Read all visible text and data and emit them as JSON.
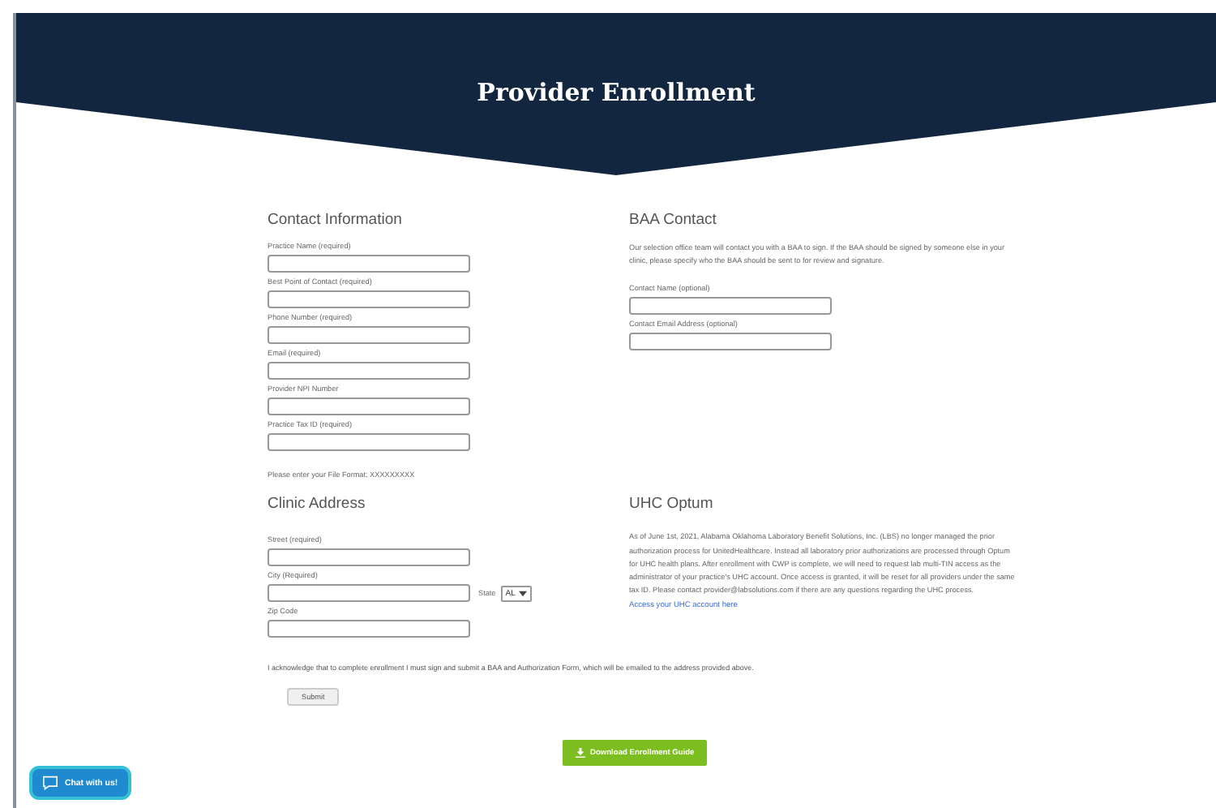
{
  "header": {
    "title": "Provider Enrollment"
  },
  "contact_information": {
    "heading": "Contact Information",
    "fields": [
      {
        "label": "Practice Name (required)"
      },
      {
        "label": "Best Point of Contact (required)"
      },
      {
        "label": "Phone Number (required)"
      },
      {
        "label": "Email (required)"
      },
      {
        "label": "Provider NPI Number"
      },
      {
        "label": "Practice Tax ID (required)"
      }
    ],
    "note": "Please enter your File Format: XXXXXXXXX"
  },
  "baa_contact": {
    "heading": "BAA Contact",
    "text": "Our selection office team will contact you with a BAA to sign. If the BAA should be signed by someone else in your clinic, please specify who the BAA should be sent to for review and signature.",
    "fields": [
      {
        "label": "Contact Name (optional)"
      },
      {
        "label": "Contact Email Address (optional)"
      }
    ]
  },
  "clinic_address": {
    "heading": "Clinic Address",
    "street": {
      "label": "Street (required)"
    },
    "city": {
      "label": "City (Required)"
    },
    "state": {
      "label": "State",
      "value": "AL"
    },
    "zip": {
      "label": "Zip Code"
    }
  },
  "uhc_optum": {
    "heading": "UHC Optum",
    "text": "As of June 1st, 2021, Alabama Oklahoma Laboratory Benefit Solutions, Inc. (LBS) no longer managed the prior authorization process for UnitedHealthcare. Instead all laboratory prior authorizations are processed through Optum for UHC health plans. After enrollment with CWP is complete, we will need to request lab multi-TIN access as the administrator of your practice's UHC account. Once access is granted, it will be reset for all providers under the same tax ID. Please contact provider@labsolutions.com if there are any questions regarding the UHC process.",
    "link": "Access your UHC account here"
  },
  "acknowledgement": "I acknowledge that to complete enrollment I must sign and submit a BAA and Authorization Form, which will be emailed to the address provided above.",
  "submit_button": "Submit",
  "download_button": "Download Enrollment Guide",
  "chat_button": "Chat with us!"
}
